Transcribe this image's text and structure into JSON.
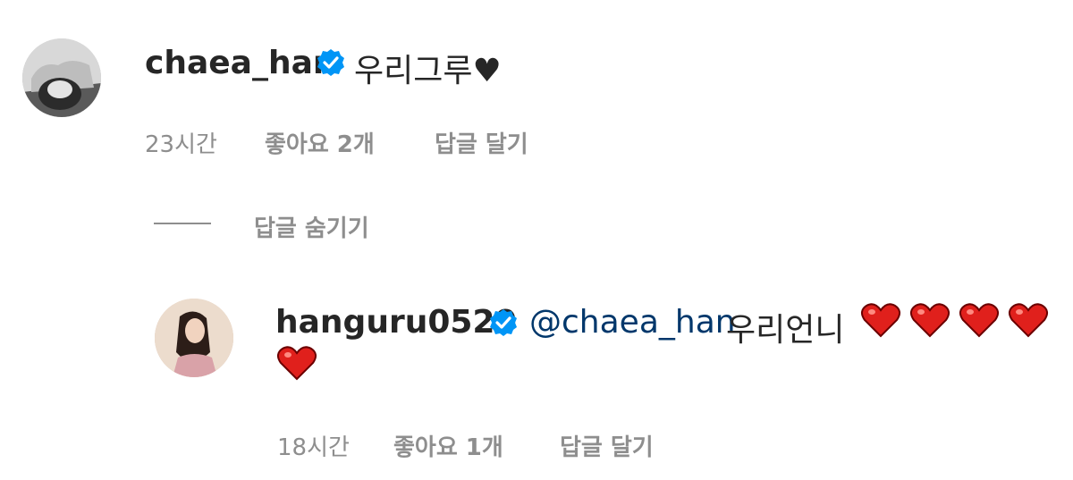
{
  "comment": {
    "username": "chaea_han",
    "text": "우리그루♥",
    "time": "23시간",
    "likes": "좋아요 2개",
    "reply_action": "답글 달기",
    "hide_replies": "답글 숨기기",
    "avatar_icon": "profile-photo",
    "verified_icon": "verified-badge-icon"
  },
  "reply": {
    "username": "hanguru0529",
    "mention": "@chaea_han",
    "text": "우리언니",
    "hearts_count": 5,
    "time": "18시간",
    "likes": "좋아요 1개",
    "reply_action": "답글 달기",
    "avatar_icon": "profile-photo",
    "verified_icon": "verified-badge-icon"
  },
  "colors": {
    "text": "#262626",
    "meta": "#8e8e8e",
    "mention": "#00376b",
    "verified": "#0095f6",
    "heart": "#e0201c"
  }
}
